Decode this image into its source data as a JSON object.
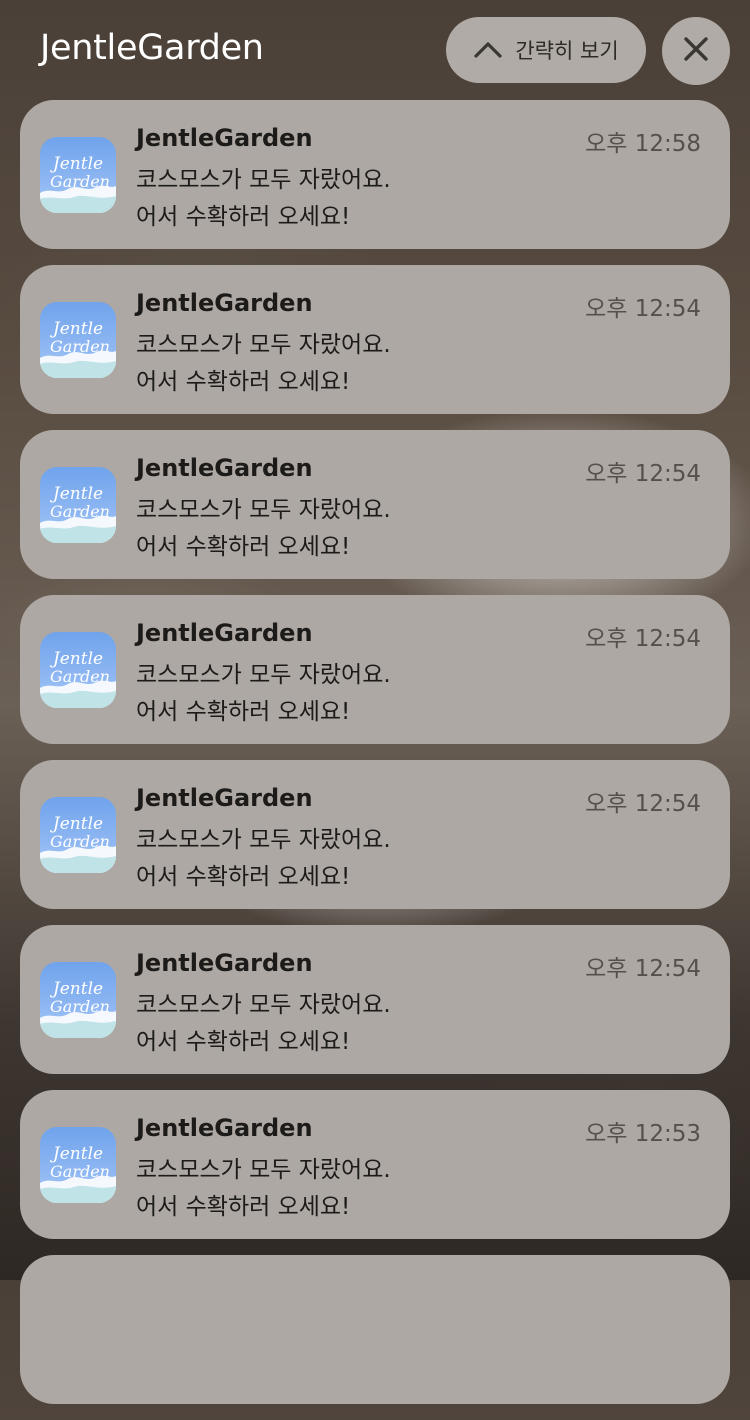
{
  "header": {
    "title": "JentleGarden",
    "collapse_label": "간략히 보기"
  },
  "notifications": [
    {
      "app": "JentleGarden",
      "time": "오후 12:58",
      "line1": "코스모스가 모두 자랐어요.",
      "line2": "어서 수확하러 오세요!"
    },
    {
      "app": "JentleGarden",
      "time": "오후 12:54",
      "line1": "코스모스가 모두 자랐어요.",
      "line2": "어서 수확하러 오세요!"
    },
    {
      "app": "JentleGarden",
      "time": "오후 12:54",
      "line1": "코스모스가 모두 자랐어요.",
      "line2": "어서 수확하러 오세요!"
    },
    {
      "app": "JentleGarden",
      "time": "오후 12:54",
      "line1": "코스모스가 모두 자랐어요.",
      "line2": "어서 수확하러 오세요!"
    },
    {
      "app": "JentleGarden",
      "time": "오후 12:54",
      "line1": "코스모스가 모두 자랐어요.",
      "line2": "어서 수확하러 오세요!"
    },
    {
      "app": "JentleGarden",
      "time": "오후 12:54",
      "line1": "코스모스가 모두 자랐어요.",
      "line2": "어서 수확하러 오세요!"
    },
    {
      "app": "JentleGarden",
      "time": "오후 12:53",
      "line1": "코스모스가 모두 자랐어요.",
      "line2": "어서 수확하러 오세요!"
    },
    {
      "app": "",
      "time": "",
      "line1": "",
      "line2": ""
    }
  ],
  "icons": {
    "collapse": "chevron-up-icon",
    "close": "close-icon",
    "app": "jentlegarden-app-icon"
  },
  "app_icon_lettering": "Jentle Garden",
  "colors": {
    "card_bg": "#ada8a3",
    "button_bg": "#b0aba6",
    "header_text": "#ffffff",
    "app_icon_blue": "#6fa3ec"
  }
}
